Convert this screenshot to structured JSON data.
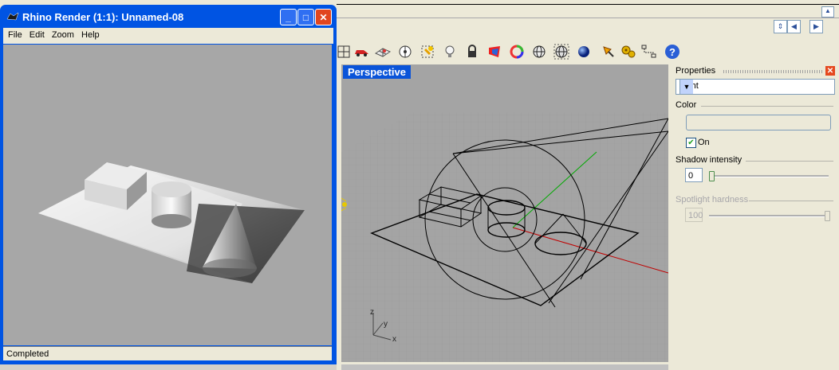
{
  "render_window": {
    "title": "Rhino Render (1:1): Unnamed-08",
    "menu": [
      "File",
      "Edit",
      "Zoom",
      "Help"
    ],
    "status": "Completed"
  },
  "viewport": {
    "title": "Perspective",
    "axis_labels": {
      "x": "x",
      "y": "y",
      "z": "z"
    }
  },
  "toolbar": {
    "icons": [
      "grid-icon",
      "car-icon",
      "mesh-icon",
      "target-icon",
      "spotlight-icon",
      "bulb-icon",
      "lock-icon",
      "material-icon",
      "color-wheel-icon",
      "sphere-wire-icon",
      "sphere-grid-icon",
      "sphere-render-icon",
      "pen-icon",
      "gear-icon",
      "nodes-icon",
      "help-icon"
    ]
  },
  "properties": {
    "header": "Properties",
    "selected": "Light",
    "color_label": "Color",
    "on_label": "On",
    "on_checked": true,
    "shadow_label": "Shadow intensity",
    "shadow_value": "0",
    "spot_label": "Spotlight hardness",
    "spot_value": "100",
    "shadow_level": 0,
    "spot_level": 1.0
  },
  "colors": {
    "titlebar": "#0054e3",
    "viewport_title": "#0a54d9",
    "x_axis": "#c00000",
    "y_axis": "#00aa00",
    "light_icon": "#e6c800"
  }
}
